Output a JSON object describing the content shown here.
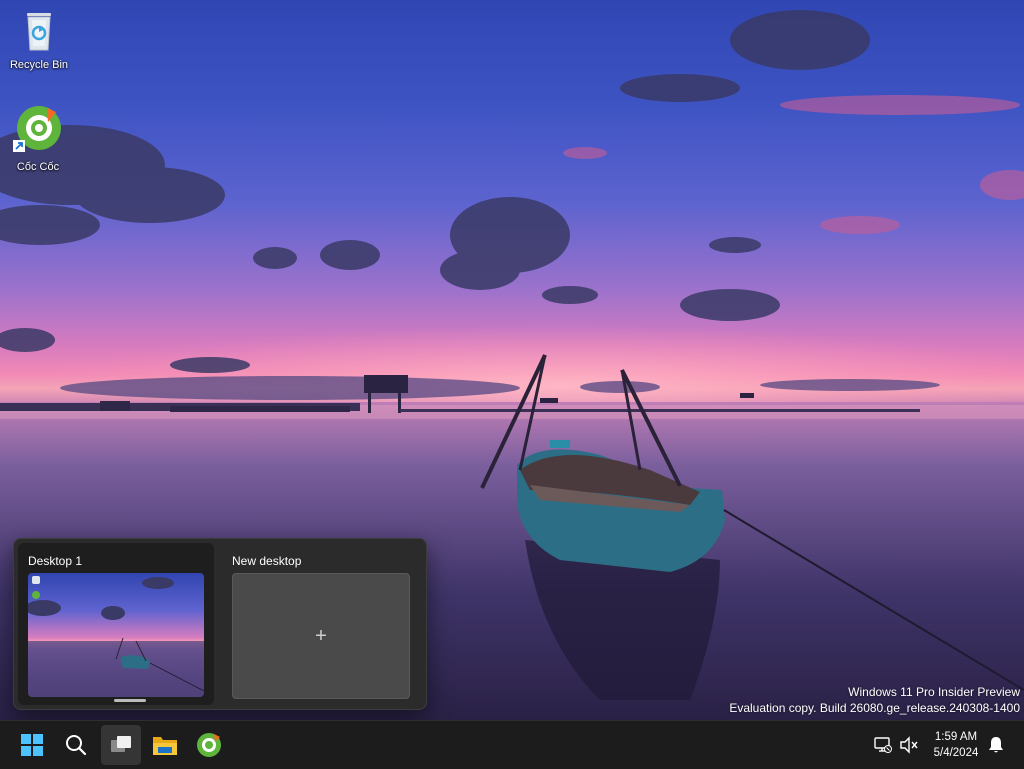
{
  "desktop_icons": [
    {
      "label": "Recycle Bin",
      "icon": "recycle-bin-icon"
    },
    {
      "label": "Cốc Cốc",
      "icon": "coc-coc-icon"
    }
  ],
  "desktops_flyout": {
    "desktops": [
      {
        "title": "Desktop 1",
        "selected": true
      }
    ],
    "new_desktop_label": "New desktop",
    "new_desktop_glyph": "+"
  },
  "watermark": {
    "line1": "Windows 11 Pro Insider Preview",
    "line2": "Evaluation copy. Build 26080.ge_release.240308-1400"
  },
  "taskbar": {
    "apps": [
      {
        "name": "start-button",
        "icon": "windows-logo-icon"
      },
      {
        "name": "search-button",
        "icon": "search-icon"
      },
      {
        "name": "task-view-button",
        "icon": "task-view-icon",
        "pressed": true
      },
      {
        "name": "file-explorer-button",
        "icon": "folder-icon"
      },
      {
        "name": "coc-coc-taskbar-button",
        "icon": "coc-coc-icon"
      }
    ],
    "tray": {
      "network_icon": "network-disconnected-icon",
      "volume_icon": "volume-muted-icon",
      "notification_icon": "bell-icon"
    },
    "clock": {
      "time": "1:59 AM",
      "date": "5/4/2024"
    }
  },
  "colors": {
    "taskbar_bg": "#1c1c1c",
    "flyout_bg": "#2b2b2b",
    "windows_blue": "#4cc2ff",
    "folder_yellow": "#f4c430",
    "coc_coc_green": "#62b83f",
    "coc_coc_orange": "#f26b22"
  }
}
